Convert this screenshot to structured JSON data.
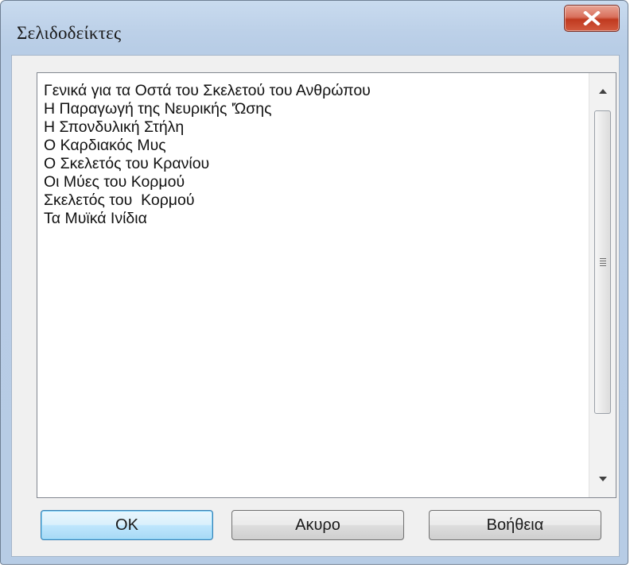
{
  "window": {
    "title": "Σελιδοδείκτες"
  },
  "bookmarks": {
    "items": [
      "Γενικά για τα Οστά του Σκελετού του Ανθρώπου",
      "Η Παραγωγή της Νευρικής 'Ώσης",
      "Η Σπονδυλική Στήλη",
      "Ο Καρδιακός Μυς",
      "Ο Σκελετός του Κρανίου",
      "Οι Μύες του Κορμού",
      "Σκελετός του  Κορμού",
      "Τα Μυϊκά Ινίδια"
    ]
  },
  "buttons": {
    "ok_label": "OK",
    "cancel_label": "Ακυρο",
    "help_label": "Βοήθεια"
  },
  "colors": {
    "close_button": "#c7432a",
    "frame": "#b9cde6",
    "ok_button_border": "#3c7fb1"
  },
  "icons": {
    "close": "close-icon",
    "scroll_up": "chevron-up-icon",
    "scroll_down": "chevron-down-icon",
    "thumb_grip": "grip-icon"
  }
}
